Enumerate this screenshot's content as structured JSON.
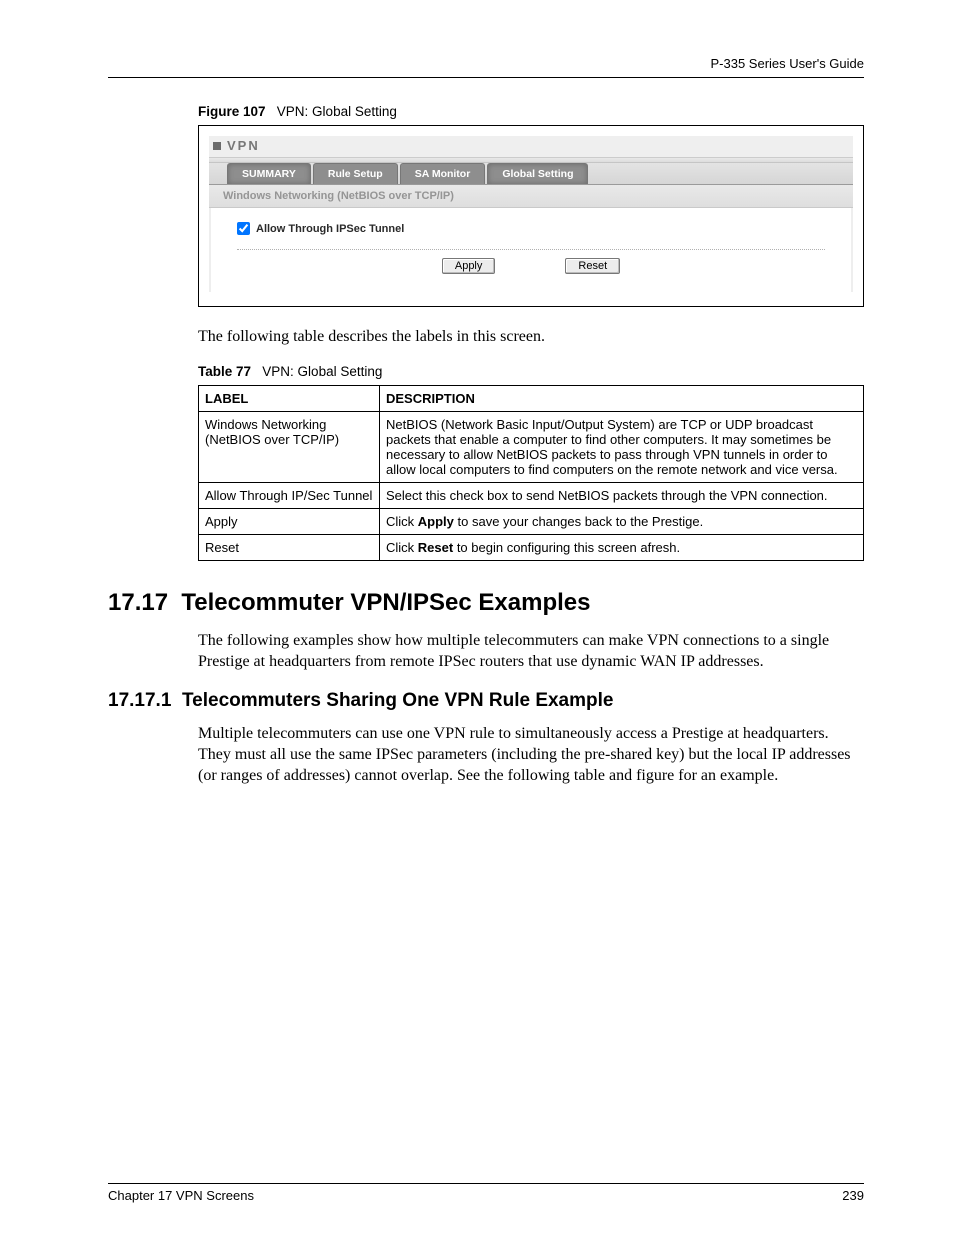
{
  "header": {
    "guide": "P-335 Series User's Guide"
  },
  "figure": {
    "label": "Figure 107",
    "title": "VPN: Global Setting",
    "screen": {
      "page_title": "VPN",
      "tabs": [
        "SUMMARY",
        "Rule Setup",
        "SA Monitor",
        "Global Setting"
      ],
      "active_tab_index": 3,
      "section_header": "Windows Networking (NetBIOS over TCP/IP)",
      "checkbox": {
        "checked": true,
        "label": "Allow Through IPSec Tunnel"
      },
      "buttons": {
        "apply": "Apply",
        "reset": "Reset"
      }
    }
  },
  "intro_text": "The following table describes the labels in this screen.",
  "table": {
    "label": "Table 77",
    "title": "VPN: Global Setting",
    "headers": {
      "c1": "LABEL",
      "c2": "DESCRIPTION"
    },
    "rows": [
      {
        "label": "Windows Networking (NetBIOS over TCP/IP)",
        "desc": "NetBIOS (Network Basic Input/Output System) are TCP or UDP broadcast packets that enable a computer to find other computers. It may sometimes be necessary to allow NetBIOS packets to pass through VPN tunnels in order to allow local computers to find computers on the remote network and vice versa."
      },
      {
        "label": "Allow Through IP/Sec Tunnel",
        "desc": "Select this check box to send NetBIOS packets through the VPN connection."
      },
      {
        "label": "Apply",
        "desc_pre": "Click ",
        "desc_bold": "Apply",
        "desc_post": " to save your changes back to the Prestige."
      },
      {
        "label": "Reset",
        "desc_pre": "Click ",
        "desc_bold": "Reset",
        "desc_post": " to begin configuring this screen afresh."
      }
    ]
  },
  "section": {
    "number": "17.17",
    "title": "Telecommuter VPN/IPSec Examples",
    "text": "The following examples show how multiple telecommuters can make VPN connections to a single Prestige at headquarters from remote IPSec routers that use dynamic WAN IP addresses."
  },
  "subsection": {
    "number": "17.17.1",
    "title": "Telecommuters Sharing One VPN Rule Example",
    "text": "Multiple telecommuters can use one VPN rule to simultaneously access a Prestige at headquarters. They must all use the same IPSec parameters (including the pre-shared key) but the local IP addresses (or ranges of addresses) cannot overlap. See the following table and figure for an example."
  },
  "footer": {
    "chapter": "Chapter 17 VPN Screens",
    "page": "239"
  }
}
